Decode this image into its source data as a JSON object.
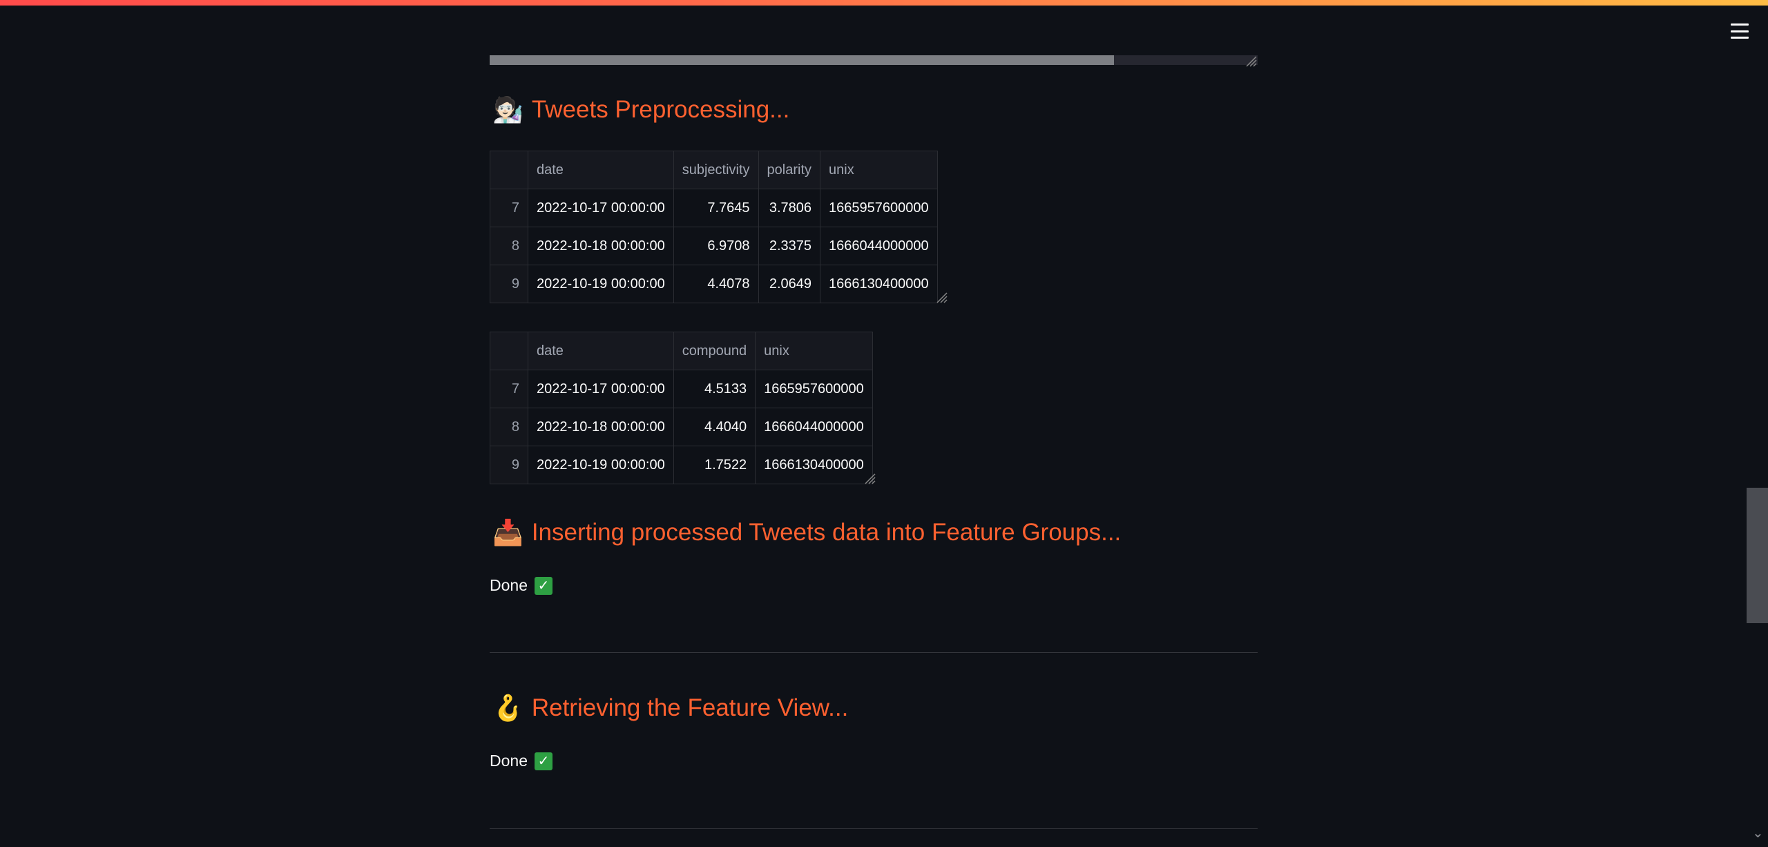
{
  "header": {
    "menu_icon": "hamburger-menu-icon"
  },
  "progress": {
    "fraction": 0.813
  },
  "sections": [
    {
      "emoji": "🧑🏻‍🔬",
      "icon": "scientist-icon",
      "title": "Tweets Preprocessing..."
    },
    {
      "emoji": "📥",
      "icon": "inbox-tray-icon",
      "title": "Inserting processed Tweets data into Feature Groups...",
      "status": "Done",
      "status_icon": "✅"
    },
    {
      "emoji": "🪝",
      "icon": "hook-icon",
      "title": "Retrieving the Feature View...",
      "status": "Done",
      "status_icon": "✅"
    }
  ],
  "table1": {
    "columns": [
      "",
      "date",
      "subjectivity",
      "polarity",
      "unix"
    ],
    "rows": [
      [
        "7",
        "2022-10-17 00:00:00",
        "7.7645",
        "3.7806",
        "1665957600000"
      ],
      [
        "8",
        "2022-10-18 00:00:00",
        "6.9708",
        "2.3375",
        "1666044000000"
      ],
      [
        "9",
        "2022-10-19 00:00:00",
        "4.4078",
        "2.0649",
        "1666130400000"
      ]
    ]
  },
  "table2": {
    "columns": [
      "",
      "date",
      "compound",
      "unix"
    ],
    "rows": [
      [
        "7",
        "2022-10-17 00:00:00",
        "4.5133",
        "1665957600000"
      ],
      [
        "8",
        "2022-10-18 00:00:00",
        "4.4040",
        "1666044000000"
      ],
      [
        "9",
        "2022-10-19 00:00:00",
        "1.7522",
        "1666130400000"
      ]
    ]
  },
  "colors": {
    "background": "#0e1117",
    "heading": "#ff6130",
    "check": "#2ea043"
  }
}
